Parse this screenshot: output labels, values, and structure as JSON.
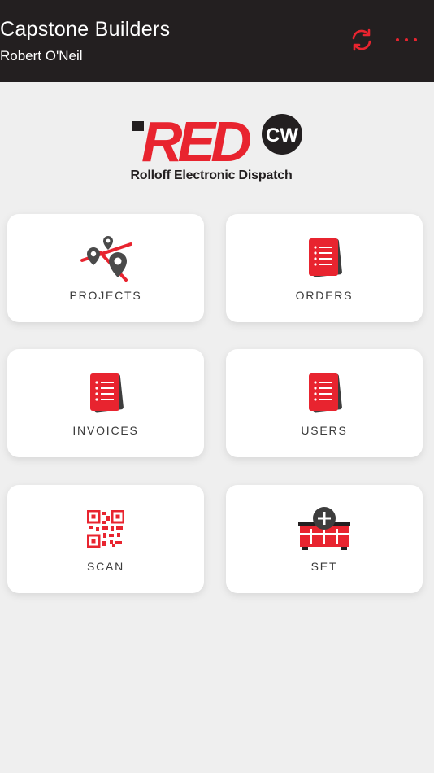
{
  "header": {
    "company": "Capstone Builders",
    "user": "Robert O'Neil",
    "sync_icon": "sync-icon",
    "more_icon": "more-dots-icon"
  },
  "logo": {
    "wordmark": "RED",
    "badge": "CW",
    "subtitle": "Rolloff Electronic Dispatch"
  },
  "tiles": [
    {
      "label": "PROJECTS",
      "icon": "map-pins-icon"
    },
    {
      "label": "ORDERS",
      "icon": "document-list-icon"
    },
    {
      "label": "INVOICES",
      "icon": "document-list-icon"
    },
    {
      "label": "USERS",
      "icon": "document-list-icon"
    },
    {
      "label": "SCAN",
      "icon": "qr-code-icon"
    },
    {
      "label": "SET",
      "icon": "container-add-icon"
    }
  ],
  "colors": {
    "accent": "#e8242f",
    "header_bg": "#231f20",
    "background": "#efefef",
    "tile_bg": "#ffffff"
  }
}
